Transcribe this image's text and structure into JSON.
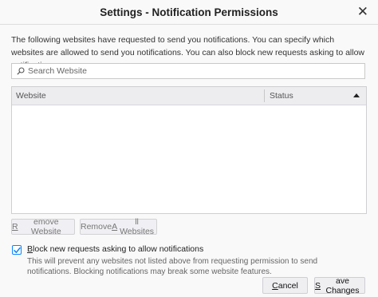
{
  "window": {
    "title": "Settings - Notification Permissions",
    "close_glyph": "✕"
  },
  "description": "The following websites have requested to send you notifications. You can specify which websites are allowed to send you notifications. You can also block new requests asking to allow notifications.",
  "search": {
    "placeholder": "Search Website",
    "value": "",
    "icon": "search-icon"
  },
  "table": {
    "columns": [
      {
        "label": "Website"
      },
      {
        "label": "Status",
        "sorted": "ascending"
      }
    ],
    "rows": []
  },
  "buttons": {
    "remove_website": {
      "label_pre": "",
      "label_key": "R",
      "label_post": "emove Website",
      "enabled": false
    },
    "remove_all": {
      "label_pre": "Remove ",
      "label_key": "A",
      "label_post": "ll Websites",
      "enabled": false
    }
  },
  "block_requests": {
    "checked": true,
    "label_pre": "",
    "label_key": "B",
    "label_post": "lock new requests asking to allow notifications",
    "description": "This will prevent any websites not listed above from requesting permission to send notifications. Blocking notifications may break some website features."
  },
  "footer": {
    "cancel": {
      "label_pre": "",
      "label_key": "C",
      "label_post": "ancel"
    },
    "save": {
      "label_pre": "",
      "label_key": "S",
      "label_post": "ave Changes"
    }
  },
  "colors": {
    "accent": "#0a84ff",
    "background": "#f9f9fa"
  }
}
